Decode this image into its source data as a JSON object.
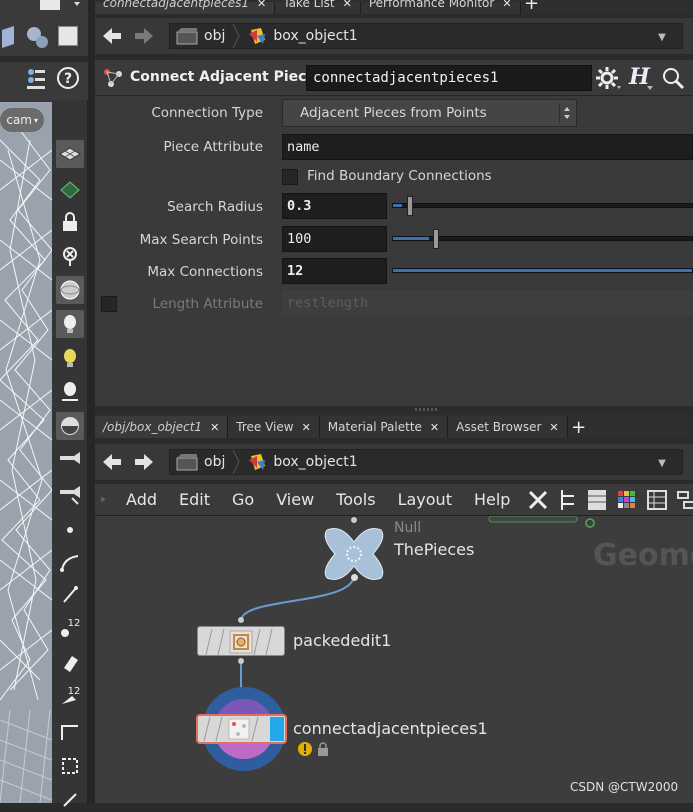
{
  "top_tabs": [
    {
      "label": "connectadjacentpieces1",
      "active": true
    },
    {
      "label": "Take List",
      "active": false
    },
    {
      "label": "Performance Monitor",
      "active": false
    }
  ],
  "top_path": {
    "crumbs": [
      "obj",
      "box_object1"
    ]
  },
  "viewport": {
    "camera_label": "cam"
  },
  "param_header": {
    "node_type": "Connect Adjacent Pieces",
    "node_name": "connectadjacentpieces1",
    "help_glyph": "H"
  },
  "params": {
    "connection_type": {
      "label": "Connection Type",
      "value": "Adjacent Pieces from Points"
    },
    "piece_attribute": {
      "label": "Piece Attribute",
      "value": "name"
    },
    "find_boundary": {
      "label": "Find Boundary Connections"
    },
    "search_radius": {
      "label": "Search Radius",
      "value": "0.3",
      "slider_fraction": 0.03
    },
    "max_search_points": {
      "label": "Max Search Points",
      "value": "100",
      "slider_fraction": 0.12
    },
    "max_connections": {
      "label": "Max Connections",
      "value": "12",
      "slider_fraction": 1.0
    },
    "length_attribute": {
      "label": "Length Attribute",
      "value": "restlength"
    }
  },
  "bottom_tabs": [
    {
      "label": "/obj/box_object1",
      "active": true
    },
    {
      "label": "Tree View",
      "active": false
    },
    {
      "label": "Material Palette",
      "active": false
    },
    {
      "label": "Asset Browser",
      "active": false
    }
  ],
  "bottom_path": {
    "crumbs": [
      "obj",
      "box_object1"
    ]
  },
  "network_menu": [
    "Add",
    "Edit",
    "Go",
    "View",
    "Tools",
    "Layout",
    "Help"
  ],
  "network": {
    "context_label": "Geome",
    "nodes": {
      "null": {
        "type": "Null",
        "name": "ThePieces"
      },
      "packededit": {
        "name": "packededit1"
      },
      "connect": {
        "name": "connectadjacentpieces1"
      }
    }
  },
  "left_tools": {
    "badge_1": "12",
    "badge_2": "12"
  },
  "watermark": "CSDN @CTW2000",
  "colors": {
    "accent_blue": "#3d6fb8",
    "node_bg": "#d8d8d8",
    "wire": "#6a9ad0",
    "warning": "#e0b000"
  }
}
